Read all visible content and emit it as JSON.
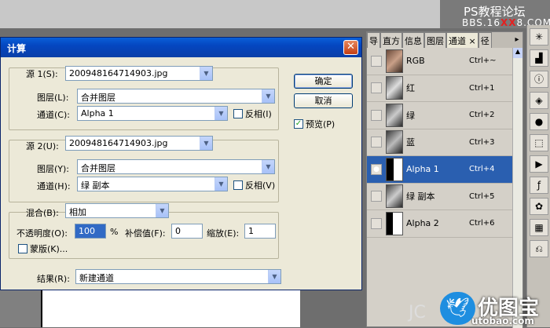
{
  "watermark": {
    "line1": "PS教程论坛",
    "line2_prefix": "BBS.16",
    "line2_red": "XX",
    "line2_suffix": "8.COM",
    "bottom_cn": "优图宝",
    "bottom_en": "utobao.com",
    "bottom_left": "JC"
  },
  "dialog": {
    "title": "计算",
    "close": "✕",
    "source1": {
      "label": "源 1(S):",
      "file": "200948164714903.jpg",
      "layer_label": "图层(L):",
      "layer": "合并图层",
      "channel_label": "通道(C):",
      "channel": "Alpha 1",
      "invert_label": "反相(I)"
    },
    "source2": {
      "label": "源 2(U):",
      "file": "200948164714903.jpg",
      "layer_label": "图层(Y):",
      "layer": "合并图层",
      "channel_label": "通道(H):",
      "channel": "绿 副本",
      "invert_label": "反相(V)"
    },
    "blend": {
      "label": "混合(B):",
      "mode": "相加",
      "opacity_label": "不透明度(O):",
      "opacity": "100",
      "percent": "%",
      "offset_label": "补偿值(F):",
      "offset": "0",
      "scale_label": "缩放(E):",
      "scale": "1",
      "mask_label": "蒙版(K)..."
    },
    "result": {
      "label": "结果(R):",
      "value": "新建通道"
    },
    "ok": "确定",
    "cancel": "取消",
    "preview_label": "预览(P)",
    "preview_checked": true
  },
  "panel": {
    "tabs": [
      "导",
      "直方",
      "信息",
      "图层",
      "通道",
      "×",
      "径"
    ],
    "active_tab": "通道",
    "channels": [
      {
        "name": "RGB",
        "shortcut": "Ctrl+~",
        "eye": false
      },
      {
        "name": "红",
        "shortcut": "Ctrl+1",
        "eye": false
      },
      {
        "name": "绿",
        "shortcut": "Ctrl+2",
        "eye": false
      },
      {
        "name": "蓝",
        "shortcut": "Ctrl+3",
        "eye": false
      },
      {
        "name": "Alpha 1",
        "shortcut": "Ctrl+4",
        "eye": true,
        "selected": true
      },
      {
        "name": "绿 副本",
        "shortcut": "Ctrl+5",
        "eye": false
      },
      {
        "name": "Alpha 2",
        "shortcut": "Ctrl+6",
        "eye": false
      }
    ]
  },
  "tools": [
    "navigator-icon",
    "histogram-icon",
    "info-icon",
    "layers-icon",
    "channels-icon",
    "paths-icon",
    "actions-icon",
    "styles-icon",
    "swatches-icon",
    "color-icon",
    "brushes-icon"
  ]
}
